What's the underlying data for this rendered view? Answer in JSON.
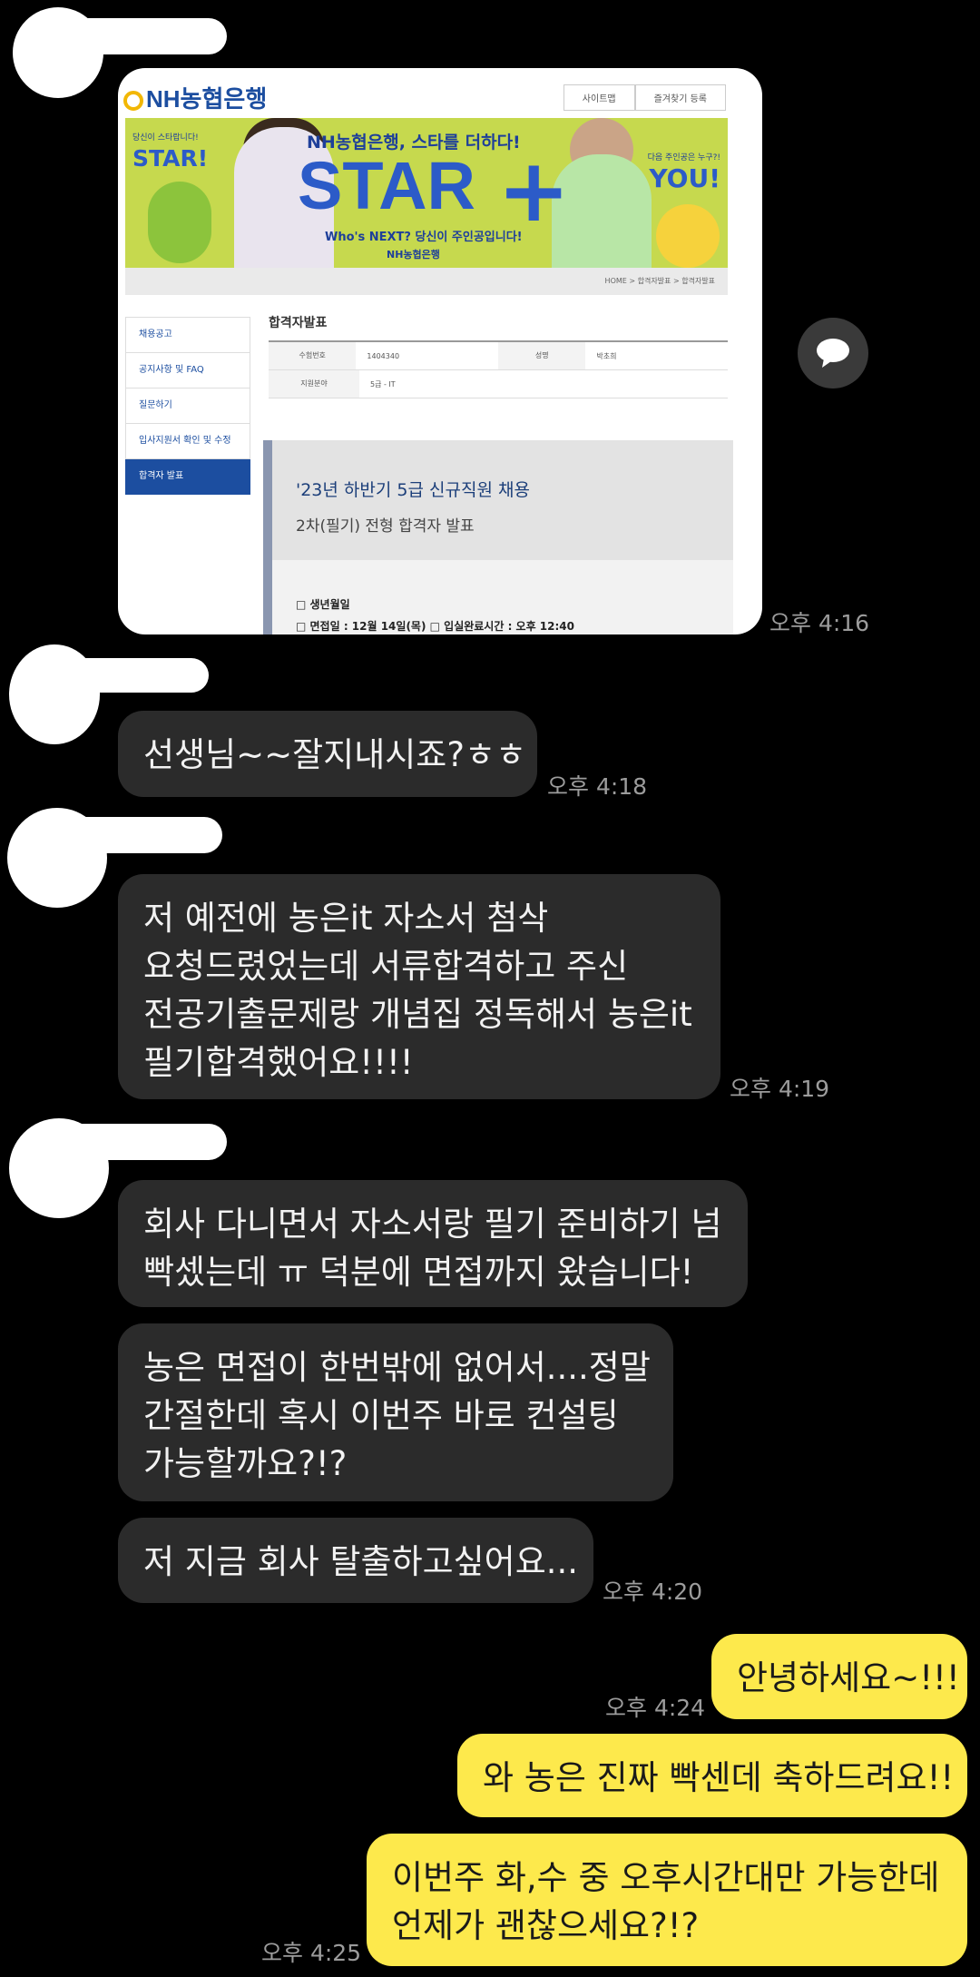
{
  "shared_image": {
    "logo": "NH농협은행",
    "top_links": [
      "사이트맵",
      "즐겨찾기 등록"
    ],
    "banner": {
      "small_left": "당신이 스타랍니다!",
      "star_left": "STAR!",
      "headline": "NH농협은행, 스타를 더하다!",
      "big": "STAR",
      "sub": "Who's NEXT? 당신이 주인공입니다!",
      "brand": "NH농협은행",
      "small_right": "다음 주인공은 누구?!",
      "you": "YOU!"
    },
    "breadcrumb": "HOME > 합격자발표 > 합격자발표",
    "side_menu": [
      "채용공고",
      "공지사항 및 FAQ",
      "질문하기",
      "입사지원서 확인 및 수정",
      "합격자 발표"
    ],
    "section_title": "합격자발표",
    "info": {
      "k1": "수험번호",
      "v1": "1404340",
      "k2": "지원분야",
      "v2": "5급 - IT",
      "k3": "성명",
      "v3": "박초희"
    },
    "doc_title": "'23년 하반기 5급 신규직원 채용",
    "doc_subtitle": "2차(필기) 전형 합격자 발표",
    "doc_line1": "□ 생년월일",
    "doc_line2": "□ 면접일 : 12월 14일(목) □ 입실완료시간 : 오후 12:40"
  },
  "messages": {
    "t1": "오후 4:16",
    "m1": "선생님~~잘지내시죠?ㅎㅎ",
    "t2": "오후 4:18",
    "m2": [
      "저 예전에 농은it 자소서 첨삭",
      "요청드렸었는데 서류합격하고 주신",
      "전공기출문제랑 개념집 정독해서 농은it",
      "필기합격했어요!!!!"
    ],
    "t3": "오후 4:19",
    "m3": [
      "회사 다니면서 자소서랑 필기 준비하기 넘",
      "빡셌는데 ㅠ 덕분에 면접까지 왔습니다!"
    ],
    "m4": [
      "농은 면접이 한번밖에 없어서....정말",
      "간절한데 혹시 이번주 바로 컨설팅",
      "가능할까요?!?"
    ],
    "m5": "저 지금 회사 탈출하고싶어요...",
    "t4": "오후 4:20",
    "o1": "안녕하세요~!!!",
    "t5": "오후 4:24",
    "o2": "와 농은 진짜 빡센데 축하드려요!!",
    "o3": [
      "이번주 화,수 중 오후시간대만 가능한데",
      "언제가 괜찮으세요?!?"
    ],
    "t6": "오후 4:25"
  },
  "colors": {
    "background": "#000000",
    "incoming": "#2b2b2b",
    "outgoing": "#fde94c"
  }
}
